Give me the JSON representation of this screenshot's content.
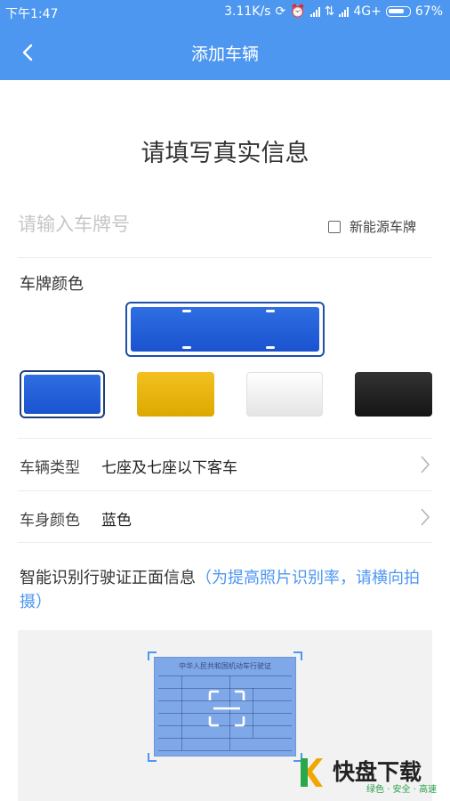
{
  "status_bar": {
    "time": "下午1:47",
    "speed": "3.11K/s",
    "network": "4G+",
    "battery": "67%"
  },
  "nav": {
    "back_icon": "chevron-left-icon",
    "title": "添加车辆"
  },
  "heading": "请填写真实信息",
  "plate": {
    "placeholder": "请输入车牌号",
    "value": "",
    "new_energy_label": "新能源车牌",
    "new_energy_checked": false
  },
  "plate_color": {
    "label": "车牌颜色",
    "selected": "blue",
    "options": [
      {
        "id": "blue",
        "color": "#1a53cf"
      },
      {
        "id": "yellow",
        "color": "#f0b90b"
      },
      {
        "id": "white",
        "color": "#ffffff"
      },
      {
        "id": "black",
        "color": "#1b1b1b"
      }
    ]
  },
  "vehicle_type": {
    "label": "车辆类型",
    "value": "七座及七座以下客车"
  },
  "body_color": {
    "label": "车身颜色",
    "value": "蓝色"
  },
  "ocr": {
    "main_text": "智能识别行驶证正面信息",
    "hint_text": "（为提高照片识别率，请横向拍摄）",
    "document_title": "中华人民共和国机动车行驶证",
    "scan_icon": "scan-icon"
  },
  "watermark": {
    "brand": "快盘下载",
    "tagline": "绿色 · 安全 · 高速"
  },
  "colors": {
    "primary": "#4d97f0",
    "plate_blue": "#1a53cf"
  }
}
